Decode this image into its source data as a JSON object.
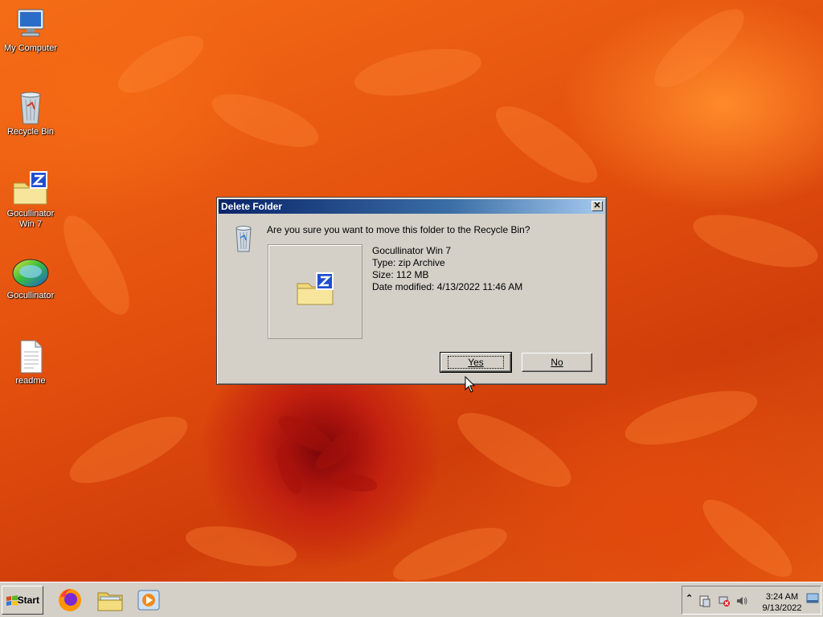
{
  "desktop": {
    "icons": [
      {
        "label": "My Computer",
        "icon": "my-computer-icon"
      },
      {
        "label": "Recycle Bin",
        "icon": "recycle-bin-icon"
      },
      {
        "label": "Gocullinator Win 7",
        "icon": "zip-folder-icon"
      },
      {
        "label": "Gocullinator",
        "icon": "gocullinator-app-icon"
      },
      {
        "label": "readme",
        "icon": "text-document-icon"
      }
    ]
  },
  "dialog": {
    "title": "Delete Folder",
    "close_label": "✕",
    "question": "Are you sure you want to move this folder to the Recycle Bin?",
    "file_name": "Gocullinator Win 7",
    "file_type": "Type: zip Archive",
    "file_size": "Size: 112 MB",
    "date_modified": "Date modified: 4/13/2022 11:46 AM",
    "yes_label": "Yes",
    "no_label": "No"
  },
  "taskbar": {
    "start_label": "Start",
    "pinned": [
      "firefox-icon",
      "file-explorer-icon",
      "media-player-icon"
    ],
    "tray": {
      "expand_label": "⌃",
      "time": "3:24 AM",
      "date": "9/13/2022"
    }
  },
  "colors": {
    "title_bar_start": "#0a246a",
    "title_bar_end": "#a6caf0",
    "dialog_bg": "#d4d0c8",
    "wallpaper_orange": "#e24e0d"
  }
}
